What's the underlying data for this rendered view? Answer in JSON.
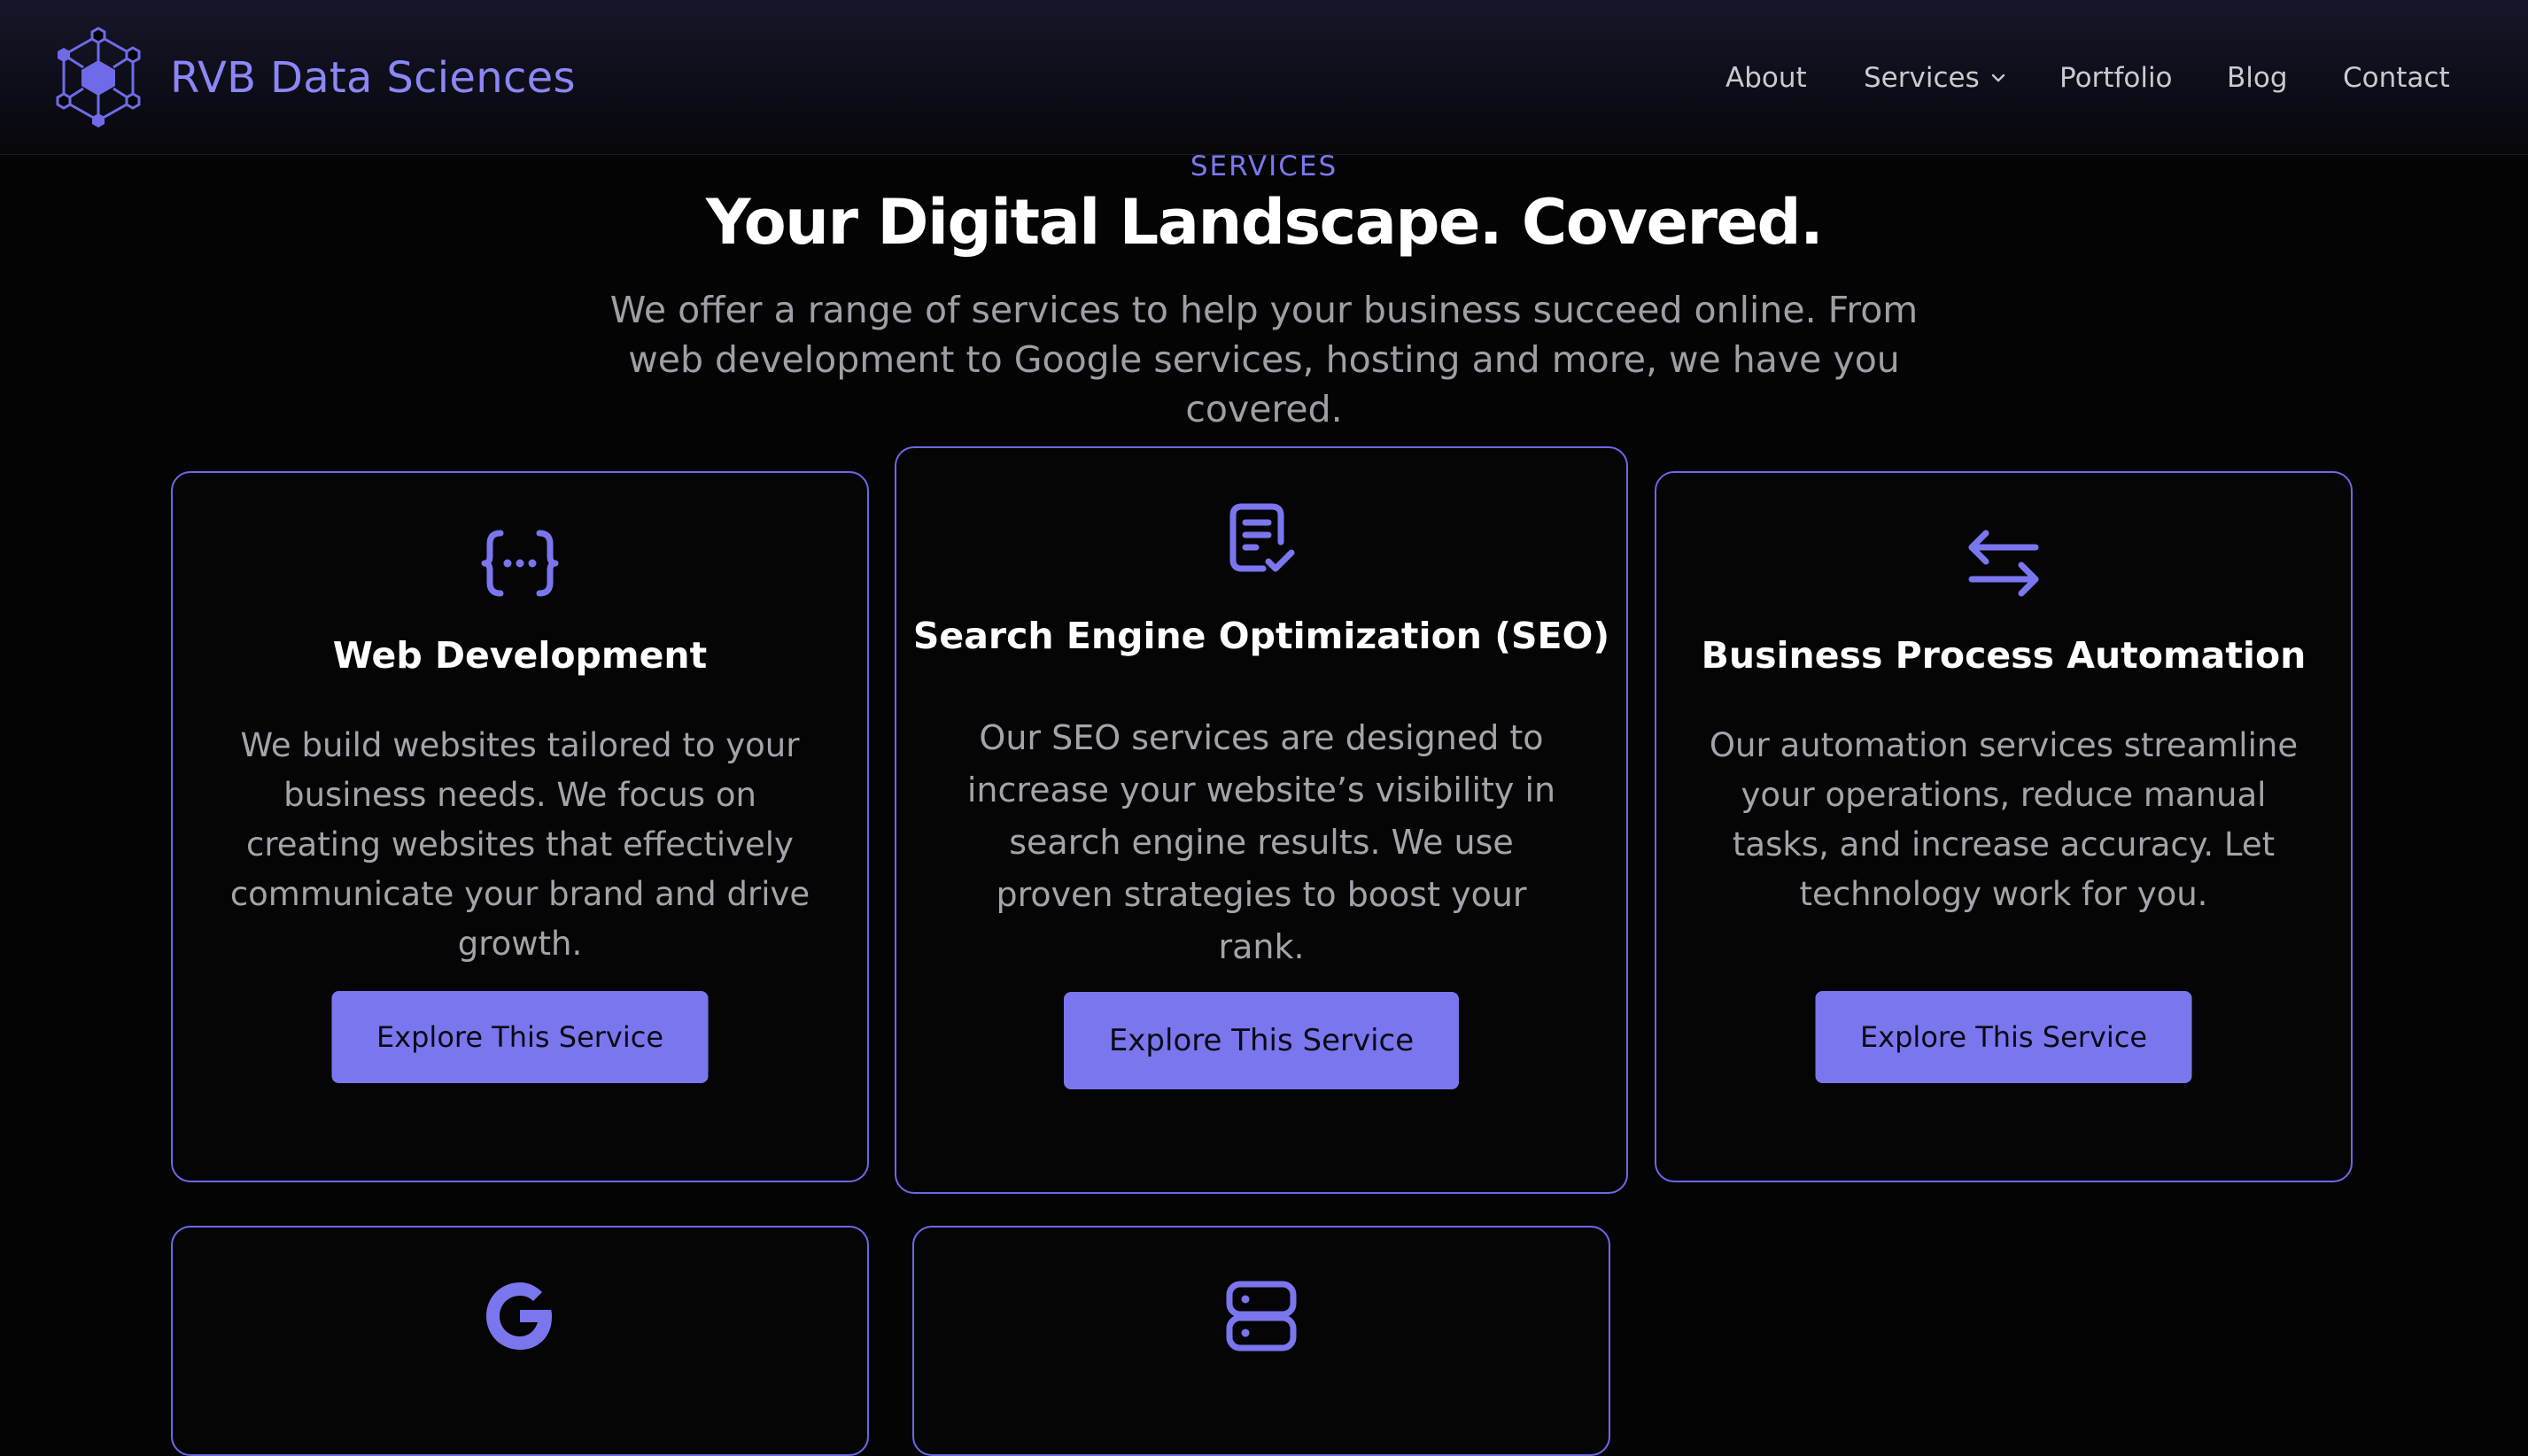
{
  "header": {
    "brand_name": "RVB Data Sciences",
    "nav": [
      {
        "label": "About"
      },
      {
        "label": "Services",
        "has_dropdown": true
      },
      {
        "label": "Portfolio"
      },
      {
        "label": "Blog"
      },
      {
        "label": "Contact"
      }
    ]
  },
  "section": {
    "eyebrow": "SERVICES",
    "title": "Your Digital Landscape. Covered.",
    "subtitle": "We offer a range of services to help your business succeed online. From web development to Google services, hosting and more, we have you covered."
  },
  "cards": [
    {
      "icon": "code-braces-icon",
      "title": "Web Development",
      "description": "We build websites tailored to your business needs. We focus on creating websites that effectively communicate your brand and drive growth.",
      "button": "Explore This Service"
    },
    {
      "icon": "document-check-icon",
      "title": "Search Engine Optimization (SEO)",
      "description": "Our SEO services are designed to increase your website’s visibility in search engine results. We use proven strategies to boost your rank.",
      "button": "Explore This Service"
    },
    {
      "icon": "arrows-exchange-icon",
      "title": "Business Process Automation",
      "description": "Our automation services streamline your operations, reduce manual tasks, and increase accuracy. Let technology work for you.",
      "button": "Explore This Service"
    },
    {
      "icon": "google-icon"
    },
    {
      "icon": "server-icon"
    }
  ],
  "colors": {
    "accent": "#7a76ee",
    "background": "#040404",
    "text_muted": "#a3a3ab"
  }
}
